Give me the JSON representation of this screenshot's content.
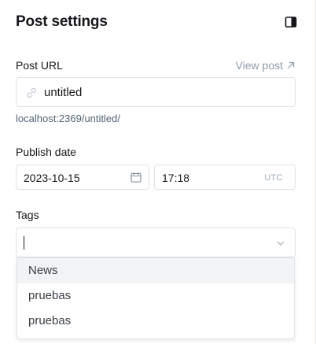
{
  "header": {
    "title": "Post settings",
    "toggle_icon": "sidebar-toggle-icon"
  },
  "post_url": {
    "label": "Post URL",
    "view_post": "View post",
    "value": "untitled",
    "hint": "localhost:2369/untitled/"
  },
  "publish_date": {
    "label": "Publish date",
    "date": "2023-10-15",
    "time": "17:18",
    "timezone": "UTC"
  },
  "tags": {
    "label": "Tags",
    "value": "",
    "options": [
      "News",
      "pruebas",
      "pruebas"
    ],
    "highlighted_index": 0
  }
}
